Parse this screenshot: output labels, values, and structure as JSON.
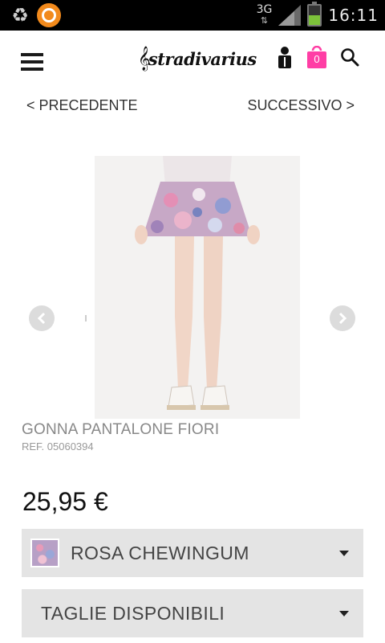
{
  "status_bar": {
    "network": "3G",
    "time": "16:11",
    "battery_level": 0.5,
    "icons": [
      "recycle-icon",
      "app-notification-icon",
      "signal-icon",
      "battery-icon"
    ]
  },
  "header": {
    "brand": "stradivarius",
    "cart_count": "0",
    "colors": {
      "cart": "#ff3ea5",
      "text": "#1a1a1a"
    }
  },
  "navigation": {
    "prev_label": "< PRECEDENTE",
    "next_label": "SUCCESSIVO >"
  },
  "product": {
    "name": "GONNA PANTALONE FIORI",
    "ref": "REF. 05060394",
    "price": "25,95 €"
  },
  "selectors": {
    "color_label": "ROSA CHEWINGUM",
    "size_label": "TAGLIE DISPONIBILI"
  }
}
